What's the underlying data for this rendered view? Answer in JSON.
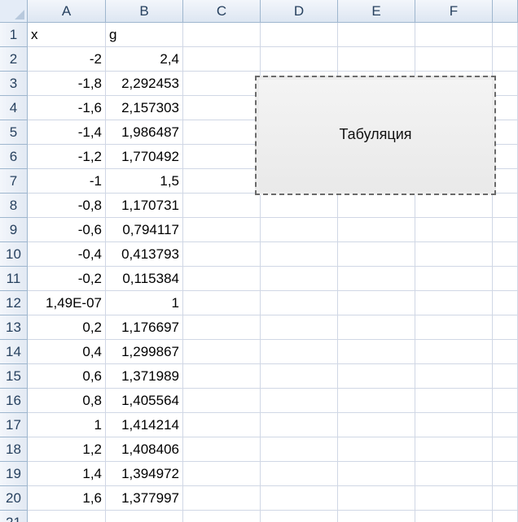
{
  "columns": [
    "A",
    "B",
    "C",
    "D",
    "E",
    "F"
  ],
  "rows": [
    {
      "n": "1",
      "a": "x",
      "b": "g"
    },
    {
      "n": "2",
      "a": "-2",
      "b": "2,4"
    },
    {
      "n": "3",
      "a": "-1,8",
      "b": "2,292453"
    },
    {
      "n": "4",
      "a": "-1,6",
      "b": "2,157303"
    },
    {
      "n": "5",
      "a": "-1,4",
      "b": "1,986487"
    },
    {
      "n": "6",
      "a": "-1,2",
      "b": "1,770492"
    },
    {
      "n": "7",
      "a": "-1",
      "b": "1,5"
    },
    {
      "n": "8",
      "a": "-0,8",
      "b": "1,170731"
    },
    {
      "n": "9",
      "a": "-0,6",
      "b": "0,794117"
    },
    {
      "n": "10",
      "a": "-0,4",
      "b": "0,413793"
    },
    {
      "n": "11",
      "a": "-0,2",
      "b": "0,115384"
    },
    {
      "n": "12",
      "a": "1,49E-07",
      "b": "1"
    },
    {
      "n": "13",
      "a": "0,2",
      "b": "1,176697"
    },
    {
      "n": "14",
      "a": "0,4",
      "b": "1,299867"
    },
    {
      "n": "15",
      "a": "0,6",
      "b": "1,371989"
    },
    {
      "n": "16",
      "a": "0,8",
      "b": "1,405564"
    },
    {
      "n": "17",
      "a": "1",
      "b": "1,414214"
    },
    {
      "n": "18",
      "a": "1,2",
      "b": "1,408406"
    },
    {
      "n": "19",
      "a": "1,4",
      "b": "1,394972"
    },
    {
      "n": "20",
      "a": "1,6",
      "b": "1,377997"
    },
    {
      "n": "21",
      "a": "",
      "b": ""
    }
  ],
  "button": {
    "label": "Табуляция"
  },
  "colors": {
    "header_bg": "#dde6f2",
    "header_border": "#9eb6ce",
    "grid_line": "#d0d7e5"
  }
}
